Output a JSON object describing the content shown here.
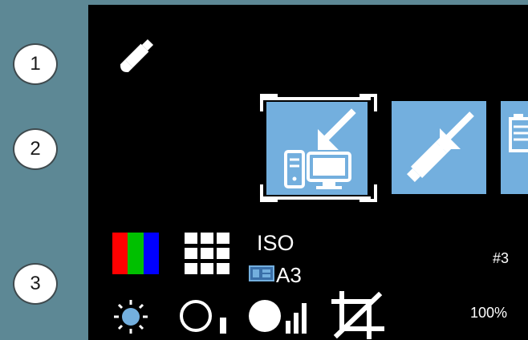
{
  "callouts": [
    "1",
    "2",
    "3"
  ],
  "icons": {
    "usb_stick": "usb-stick-icon",
    "pc_import": "import-to-pc-icon",
    "usb_import": "import-to-usb-icon",
    "document_import": "import-document-icon",
    "color_mode": "color-rgb-icon",
    "grid_layout": "grid-layout-icon",
    "brightness": "brightness-icon",
    "contrast": "contrast-icon",
    "density": "density-icon",
    "crop": "crop-icon"
  },
  "settings": {
    "paper_standard": "ISO",
    "paper_size": "A3",
    "copies": "#3",
    "zoom": "100%"
  },
  "colors": {
    "sidebar": "#5d8895",
    "screen": "#000000",
    "tile": "#73afde",
    "brightness_dot": "#73afde"
  }
}
